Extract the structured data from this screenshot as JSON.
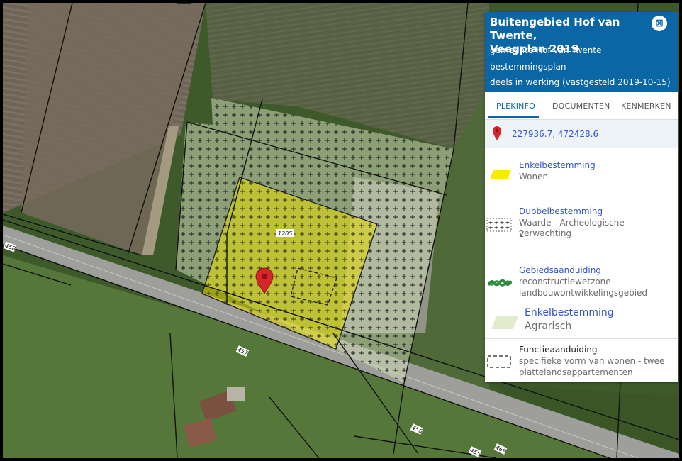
{
  "panel": {
    "title_line1": "Buitengebied Hof van Twente,",
    "title_line2": "Veegplan 2019",
    "municipality": "gemeente Hof van Twente",
    "plan_type": "bestemmingsplan",
    "status": "deels in werking (vastgesteld 2019-10-15)",
    "close_icon": "close-icon"
  },
  "tabs": [
    {
      "label": "PLEKINFO",
      "active": true
    },
    {
      "label": "DOCUMENTEN",
      "active": false
    },
    {
      "label": "KENMERKEN",
      "active": false
    }
  ],
  "location": {
    "coordinates": "227936.7, 472428.6",
    "icon": "map-marker-icon"
  },
  "entries": [
    {
      "category": "Enkelbestemming",
      "value": "Wonen",
      "icon": "yellow-parallelogram-icon",
      "color": "#f5ec00"
    },
    {
      "category": "Dubbelbestemming",
      "value_line1": "Waarde - Archeologische verwachting",
      "value_line2": "2",
      "icon": "cross-hatch-pattern-icon"
    },
    {
      "category": "Gebiedsaanduiding",
      "value_line1": "reconstructiewetzone -",
      "value_line2": "landbouwontwikkelingsgebied",
      "icon": "green-braided-line-icon",
      "color": "#2e8b3c"
    },
    {
      "category": "Enkelbestemming",
      "value": "Agrarisch",
      "icon": "pale-green-parallelogram-icon",
      "color": "#e3ebcd"
    },
    {
      "category": "Functieaanduiding",
      "value_line1": "specifieke vorm van wonen - twee",
      "value_line2": "plattelandsappartementen",
      "icon": "dashed-rectangle-icon"
    }
  ],
  "map": {
    "parcel_labels": [
      "1205",
      "458",
      "457",
      "456",
      "455",
      "469"
    ],
    "marker_color": "#d6262a",
    "wonen_color": "#e6dc00",
    "agrarisch_color": "#cdd8b4"
  }
}
